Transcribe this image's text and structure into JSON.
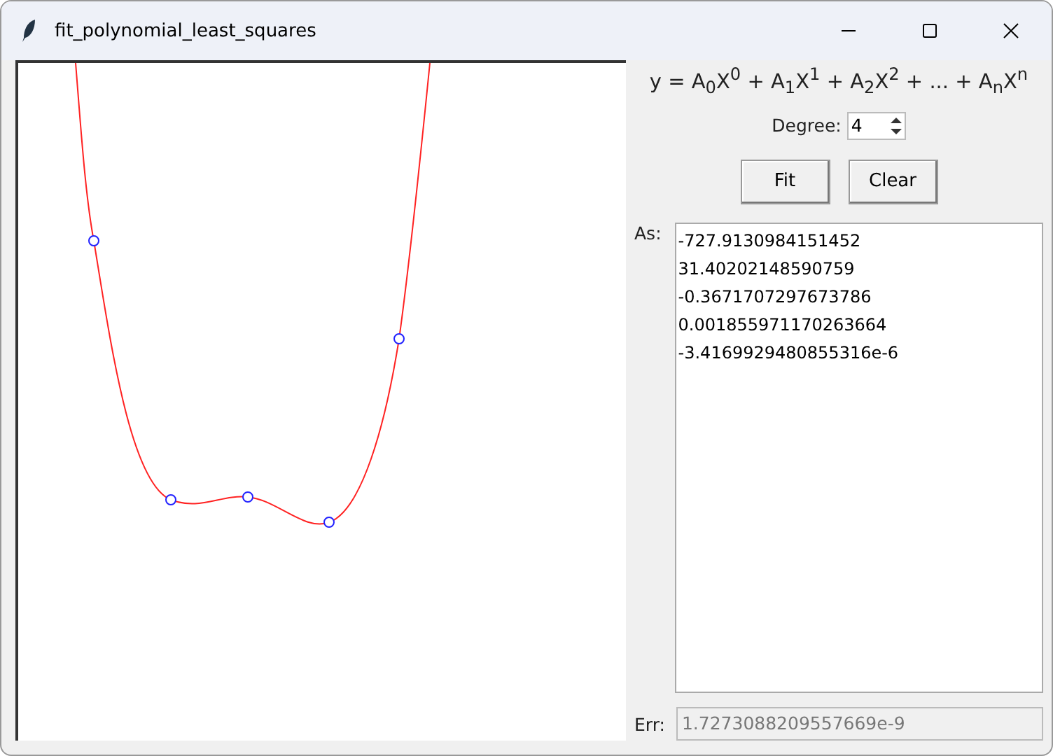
{
  "window": {
    "title": "fit_polynomial_least_squares"
  },
  "equation": "y = A$_{0}$X$^{0}$ + A$_{1}$X$^{1}$ + A$_{2}$X$^{2}$ + ... + A$_{n}$X$^{n}$",
  "degree": {
    "label": "Degree:",
    "value": "4"
  },
  "buttons": [
    "Fit",
    "Clear"
  ],
  "coefficients": {
    "label": "As:",
    "values": [
      "-727.9130984151452",
      "31.40202148590759",
      "-0.3671707297673786",
      "0.001855971170263664",
      "-3.4169929480855316e-6"
    ]
  },
  "error": {
    "label": "Err:",
    "value": "1.7273088209557669e-9",
    "disabled": true
  }
}
